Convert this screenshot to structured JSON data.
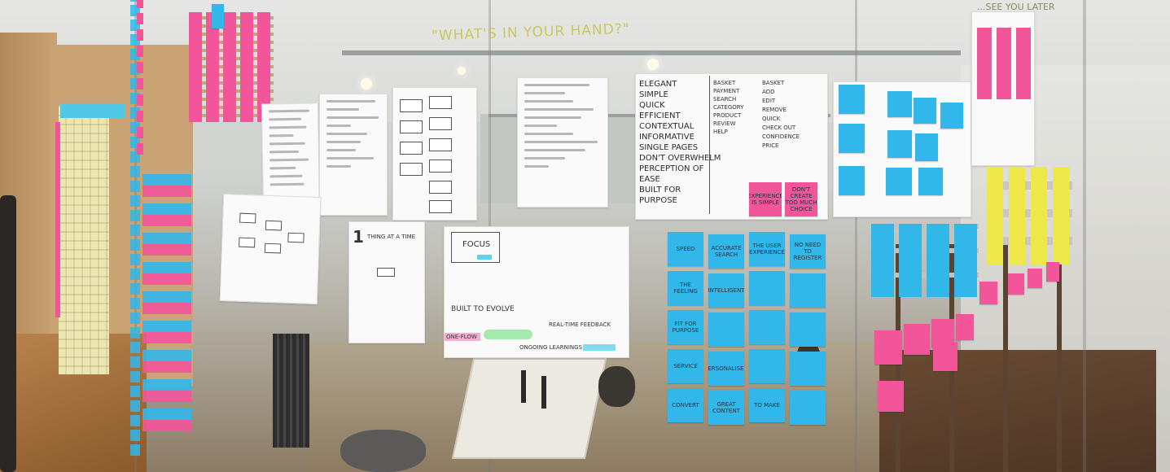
{
  "ceiling_text": "\"WHAT'S IN YOUR HAND?\"",
  "corner_text": "...SEE YOU LATER",
  "poster_step": {
    "number": "1",
    "caption": "THING AT A TIME"
  },
  "poster_focus": {
    "title": "FOCUS",
    "evolve": "BUILT TO EVOLVE",
    "one_flow": "ONE-FLOW",
    "realtime": "REAL-TIME FEEDBACK",
    "ongoing": "ONGOING LEARNINGS"
  },
  "poster_principles": {
    "column_left": [
      "ELEGANT",
      "SIMPLE",
      "QUICK",
      "EFFICIENT",
      "CONTEXTUAL",
      "INFORMATIVE",
      "SINGLE PAGES",
      "DON'T OVERWHELM",
      "PERCEPTION OF",
      "EASE",
      "BUILT FOR",
      "PURPOSE"
    ],
    "column_mid": [
      "BASKET",
      "PAYMENT",
      "SEARCH",
      "CATEGORY",
      "PRODUCT",
      "REVIEW",
      "HELP"
    ],
    "column_right": [
      "BASKET",
      "ADD",
      "EDIT",
      "REMOVE",
      "QUICK",
      "CHECK OUT",
      "CONFIDENCE",
      "PRICE"
    ]
  },
  "notes_pink_center": [
    "EXPERIENCE IS SIMPLE",
    "DON'T CREATE TOO MUCH CHOICE"
  ],
  "notes_blue_center": [
    "SPEED",
    "ACCURATE SEARCH",
    "THE USER EXPERIENCE",
    "NO NEED TO REGISTER",
    "THE FEELING",
    "INTELLIGENT",
    "",
    "",
    "FIT FOR PURPOSE",
    "",
    "",
    "",
    "SERVICE",
    "PERSONALISED",
    "",
    "",
    "CONVERT",
    "GREAT CONTENT",
    "TO MAKE",
    ""
  ],
  "colors": {
    "pink": "#f2559a",
    "blue": "#32b7ea",
    "yellow": "#efe84a",
    "wood": "#c9a374"
  }
}
